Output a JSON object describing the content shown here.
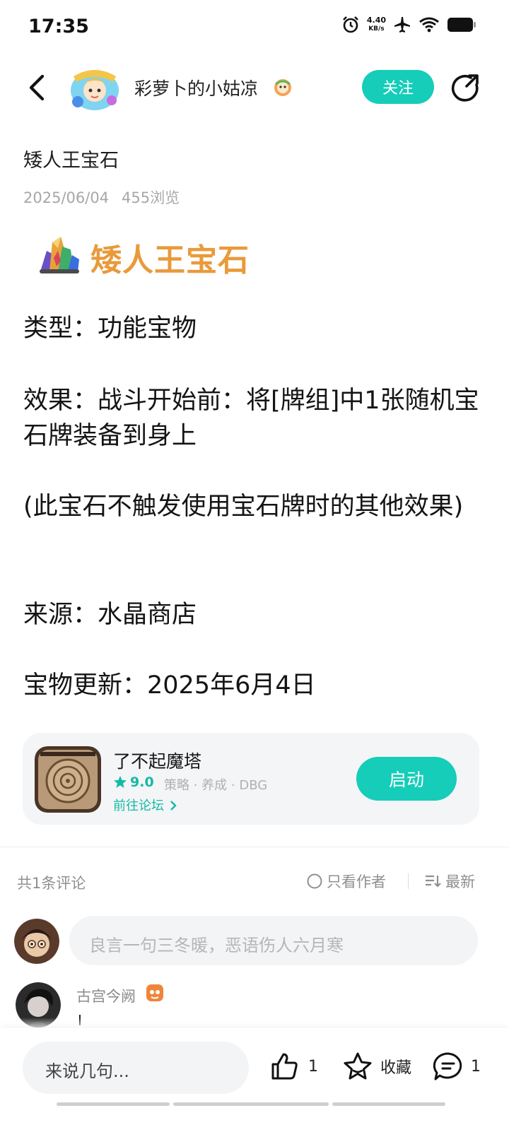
{
  "status_bar": {
    "time": "17:35",
    "net_speed_value": "4.40",
    "net_speed_unit": "KB/s",
    "icons": [
      "alarm-icon",
      "airplane-icon",
      "wifi-icon",
      "battery-icon"
    ]
  },
  "header": {
    "author_name": "彩萝卜的小姑凉",
    "follow_label": "关注",
    "icons": [
      "back-arrow-icon",
      "share-icon"
    ]
  },
  "post": {
    "title": "矮人王宝石",
    "date": "2025/06/04",
    "views": "455浏览",
    "headline": "矮人王宝石",
    "paragraphs": [
      "类型：功能宝物",
      "效果：战斗开始前：将[牌组]中1张随机宝石牌装备到身上",
      "(此宝石不触发使用宝石牌时的其他效果)",
      "来源：水晶商店",
      "宝物更新：2025年6月4日"
    ]
  },
  "app_card": {
    "name": "了不起魔塔",
    "rating": "9.0",
    "tags": "策略 · 养成 · DBG",
    "forum_link": "前往论坛",
    "launch_label": "启动"
  },
  "comments": {
    "count_label": "共1条评论",
    "only_author_label": "只看作者",
    "sort_label": "最新",
    "input_placeholder": "良言一句三冬暖，恶语伤人六月寒",
    "items": [
      {
        "user": "古宫今阙",
        "text": "I"
      }
    ]
  },
  "bottom_bar": {
    "say_placeholder": "来说几句...",
    "like_count": "1",
    "favorite_label": "收藏",
    "comment_count": "1"
  },
  "colors": {
    "accent": "#15cdb9",
    "headline_orange": "#e99a3a",
    "meta_gray": "#a7a7a7"
  }
}
